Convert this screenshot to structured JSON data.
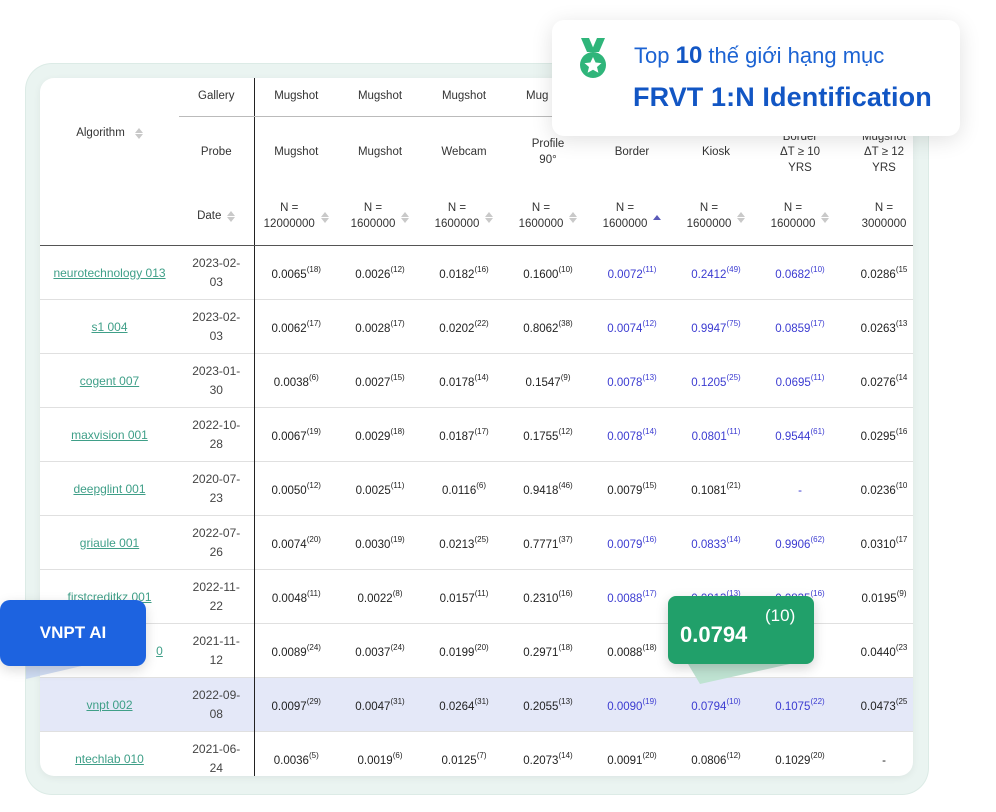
{
  "callout": {
    "line1_prefix": "Top ",
    "line1_num": "10",
    "line1_suffix": " thế giới hạng mục",
    "line2": "FRVT 1:N Identification",
    "icon": "medal-icon"
  },
  "badge": {
    "label": "VNPT AI"
  },
  "highlight": {
    "value": "0.0794",
    "rank": "(10)"
  },
  "colors": {
    "accent_blue": "#1256c4",
    "link_green": "#3f9f88",
    "value_blue": "#3b3bd1",
    "badge_green": "#21a06a",
    "badge_blue": "#1d63e0"
  },
  "table": {
    "algorithm_label": "Algorithm",
    "gallery_label": "Gallery",
    "probe_label": "Probe",
    "date_label": "Date",
    "columns": [
      {
        "gallery": "Mugshot",
        "probe": "Mugshot",
        "n": "N =\n12000000"
      },
      {
        "gallery": "Mugshot",
        "probe": "Mugshot",
        "n": "N =\n1600000"
      },
      {
        "gallery": "Mugshot",
        "probe": "Webcam",
        "n": "N =\n1600000"
      },
      {
        "gallery": "Mug",
        "probe": "Profile\n90°",
        "n": "N =\n1600000"
      },
      {
        "gallery": "",
        "probe": "Border",
        "n": "N =\n1600000"
      },
      {
        "gallery": "",
        "probe": "Kiosk",
        "n": "N =\n1600000"
      },
      {
        "gallery": "",
        "probe": "Border\nΔT ≥ 10\nYRS",
        "n": "N =\n1600000"
      },
      {
        "gallery": "",
        "probe": "Mugshot\nΔT ≥ 12\nYRS",
        "n": "N =\n3000000"
      }
    ],
    "rows": [
      {
        "name": "neurotechnology 013",
        "date": "2023-02-\n03",
        "cells": [
          {
            "v": "0.0065",
            "r": "(18)"
          },
          {
            "v": "0.0026",
            "r": "(12)"
          },
          {
            "v": "0.0182",
            "r": "(16)"
          },
          {
            "v": "0.1600",
            "r": "(10)"
          },
          {
            "v": "0.0072",
            "r": "(11)"
          },
          {
            "v": "0.2412",
            "r": "(49)"
          },
          {
            "v": "0.0682",
            "r": "(10)"
          },
          {
            "v": "0.0286",
            "r": "(15"
          }
        ]
      },
      {
        "name": "s1 004",
        "date": "2023-02-\n03",
        "cells": [
          {
            "v": "0.0062",
            "r": "(17)"
          },
          {
            "v": "0.0028",
            "r": "(17)"
          },
          {
            "v": "0.0202",
            "r": "(22)"
          },
          {
            "v": "0.8062",
            "r": "(38)"
          },
          {
            "v": "0.0074",
            "r": "(12)"
          },
          {
            "v": "0.9947",
            "r": "(75)"
          },
          {
            "v": "0.0859",
            "r": "(17)"
          },
          {
            "v": "0.0263",
            "r": "(13"
          }
        ]
      },
      {
        "name": "cogent 007",
        "date": "2023-01-\n30",
        "cells": [
          {
            "v": "0.0038",
            "r": "(6)"
          },
          {
            "v": "0.0027",
            "r": "(15)"
          },
          {
            "v": "0.0178",
            "r": "(14)"
          },
          {
            "v": "0.1547",
            "r": "(9)"
          },
          {
            "v": "0.0078",
            "r": "(13)"
          },
          {
            "v": "0.1205",
            "r": "(25)"
          },
          {
            "v": "0.0695",
            "r": "(11)"
          },
          {
            "v": "0.0276",
            "r": "(14"
          }
        ]
      },
      {
        "name": "maxvision 001",
        "date": "2022-10-\n28",
        "cells": [
          {
            "v": "0.0067",
            "r": "(19)"
          },
          {
            "v": "0.0029",
            "r": "(18)"
          },
          {
            "v": "0.0187",
            "r": "(17)"
          },
          {
            "v": "0.1755",
            "r": "(12)"
          },
          {
            "v": "0.0078",
            "r": "(14)"
          },
          {
            "v": "0.0801",
            "r": "(11)"
          },
          {
            "v": "0.9544",
            "r": "(61)"
          },
          {
            "v": "0.0295",
            "r": "(16"
          }
        ]
      },
      {
        "name": "deepglint 001",
        "date": "2020-07-\n23",
        "cells": [
          {
            "v": "0.0050",
            "r": "(12)"
          },
          {
            "v": "0.0025",
            "r": "(11)"
          },
          {
            "v": "0.0116",
            "r": "(6)"
          },
          {
            "v": "0.9418",
            "r": "(46)"
          },
          {
            "v": "0.0079",
            "r": "(15)"
          },
          {
            "v": "0.1081",
            "r": "(21)"
          },
          {
            "v": "-",
            "r": ""
          },
          {
            "v": "0.0236",
            "r": "(10"
          }
        ]
      },
      {
        "name": "griaule 001",
        "date": "2022-07-\n26",
        "cells": [
          {
            "v": "0.0074",
            "r": "(20)"
          },
          {
            "v": "0.0030",
            "r": "(19)"
          },
          {
            "v": "0.0213",
            "r": "(25)"
          },
          {
            "v": "0.7771",
            "r": "(37)"
          },
          {
            "v": "0.0079",
            "r": "(16)"
          },
          {
            "v": "0.0833",
            "r": "(14)"
          },
          {
            "v": "0.9906",
            "r": "(62)"
          },
          {
            "v": "0.0310",
            "r": "(17"
          }
        ]
      },
      {
        "name": "firstcreditkz 001",
        "date": "2022-11-\n22",
        "cells": [
          {
            "v": "0.0048",
            "r": "(11)"
          },
          {
            "v": "0.0022",
            "r": "(8)"
          },
          {
            "v": "0.0157",
            "r": "(11)"
          },
          {
            "v": "0.2310",
            "r": "(16)"
          },
          {
            "v": "0.0088",
            "r": "(17)"
          },
          {
            "v": "0.0813",
            "r": "(13)"
          },
          {
            "v": "0.0835",
            "r": "(16)"
          },
          {
            "v": "0.0195",
            "r": "(9)"
          }
        ]
      },
      {
        "name": "0",
        "date": "2021-11-\n12",
        "cells": [
          {
            "v": "0.0089",
            "r": "(24)"
          },
          {
            "v": "0.0037",
            "r": "(24)"
          },
          {
            "v": "0.0199",
            "r": "(20)"
          },
          {
            "v": "0.2971",
            "r": "(18)"
          },
          {
            "v": "0.0088",
            "r": "(18)"
          },
          {
            "v": "",
            "r": ""
          },
          {
            "v": "",
            "r": "19)"
          },
          {
            "v": "0.0440",
            "r": "(23"
          }
        ]
      },
      {
        "name": "vnpt 002",
        "date": "2022-09-\n08",
        "cells": [
          {
            "v": "0.0097",
            "r": "(29)"
          },
          {
            "v": "0.0047",
            "r": "(31)"
          },
          {
            "v": "0.0264",
            "r": "(31)"
          },
          {
            "v": "0.2055",
            "r": "(13)"
          },
          {
            "v": "0.0090",
            "r": "(19)"
          },
          {
            "v": "0.0794",
            "r": "(10)"
          },
          {
            "v": "0.1075",
            "r": "(22)"
          },
          {
            "v": "0.0473",
            "r": "(25"
          }
        ]
      },
      {
        "name": "ntechlab 010",
        "date": "2021-06-\n24",
        "cells": [
          {
            "v": "0.0036",
            "r": "(5)"
          },
          {
            "v": "0.0019",
            "r": "(6)"
          },
          {
            "v": "0.0125",
            "r": "(7)"
          },
          {
            "v": "0.2073",
            "r": "(14)"
          },
          {
            "v": "0.0091",
            "r": "(20)"
          },
          {
            "v": "0.0806",
            "r": "(12)"
          },
          {
            "v": "0.1029",
            "r": "(20)"
          },
          {
            "v": "-",
            "r": ""
          }
        ]
      }
    ]
  }
}
